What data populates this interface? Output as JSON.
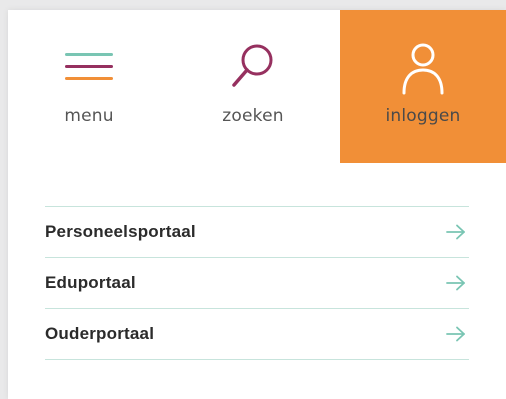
{
  "colors": {
    "accent_orange": "#f18f37",
    "menu_line_teal": "#79c5b3",
    "menu_line_purple": "#96305f",
    "menu_line_orange": "#f18f37",
    "search_purple": "#96305f",
    "arrow_teal": "#79c5b3"
  },
  "header": {
    "menu": {
      "label": "menu",
      "icon": "hamburger-menu-icon"
    },
    "search": {
      "label": "zoeken",
      "icon": "magnifier-icon"
    },
    "login": {
      "label": "inloggen",
      "icon": "user-icon"
    }
  },
  "portals": [
    {
      "label": "Personeelsportaal",
      "icon": "arrow-right-icon"
    },
    {
      "label": "Eduportaal",
      "icon": "arrow-right-icon"
    },
    {
      "label": "Ouderportaal",
      "icon": "arrow-right-icon"
    }
  ]
}
